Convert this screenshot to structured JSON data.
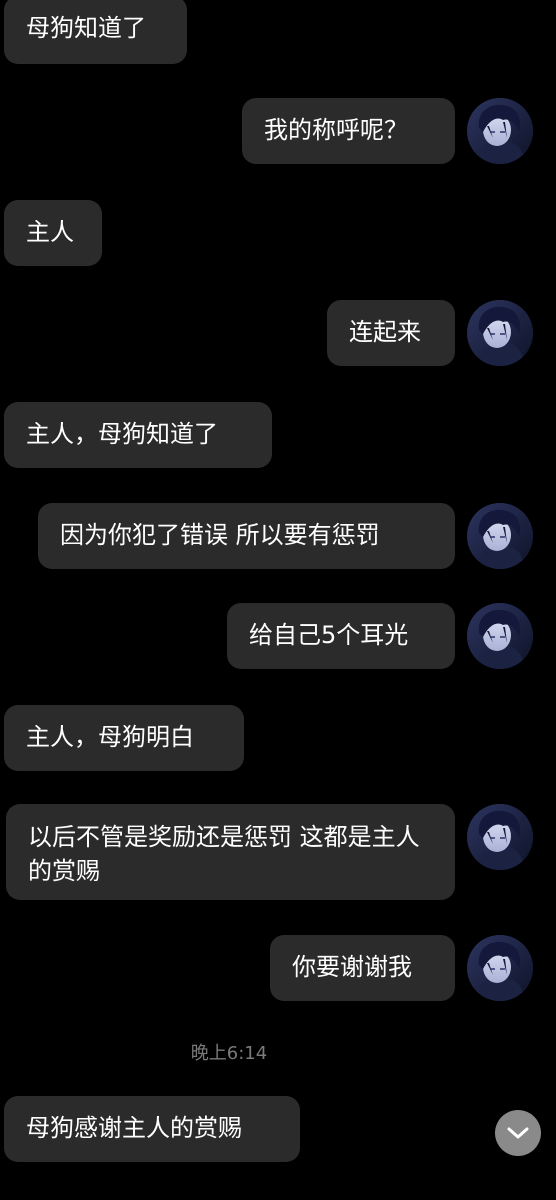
{
  "chat": {
    "messages": [
      {
        "sender": "them",
        "text": "母狗知道了"
      },
      {
        "sender": "me",
        "text": "我的称呼呢？"
      },
      {
        "sender": "them",
        "text": "主人"
      },
      {
        "sender": "me",
        "text": "连起来"
      },
      {
        "sender": "them",
        "text": "主人，母狗知道了"
      },
      {
        "sender": "me",
        "text": "因为你犯了错误 所以要有惩罚"
      },
      {
        "sender": "me",
        "text": "给自己5个耳光"
      },
      {
        "sender": "them",
        "text": "主人，母狗明白"
      },
      {
        "sender": "me",
        "text": "以后不管是奖励还是惩罚  这都是主人的赏赐"
      },
      {
        "sender": "me",
        "text": "你要谢谢我"
      },
      {
        "sender": "them",
        "text": "母狗感谢主人的赏赐"
      }
    ],
    "timestamp": "晚上6:14",
    "avatar_icon": "avatar-icon",
    "scroll_button_icon": "chevron-down-icon"
  },
  "colors": {
    "background": "#000000",
    "bubble": "#2b2b2b",
    "text": "#ffffff",
    "timestamp": "#7a7a7a",
    "scroll_button": "#8a8a8a"
  }
}
